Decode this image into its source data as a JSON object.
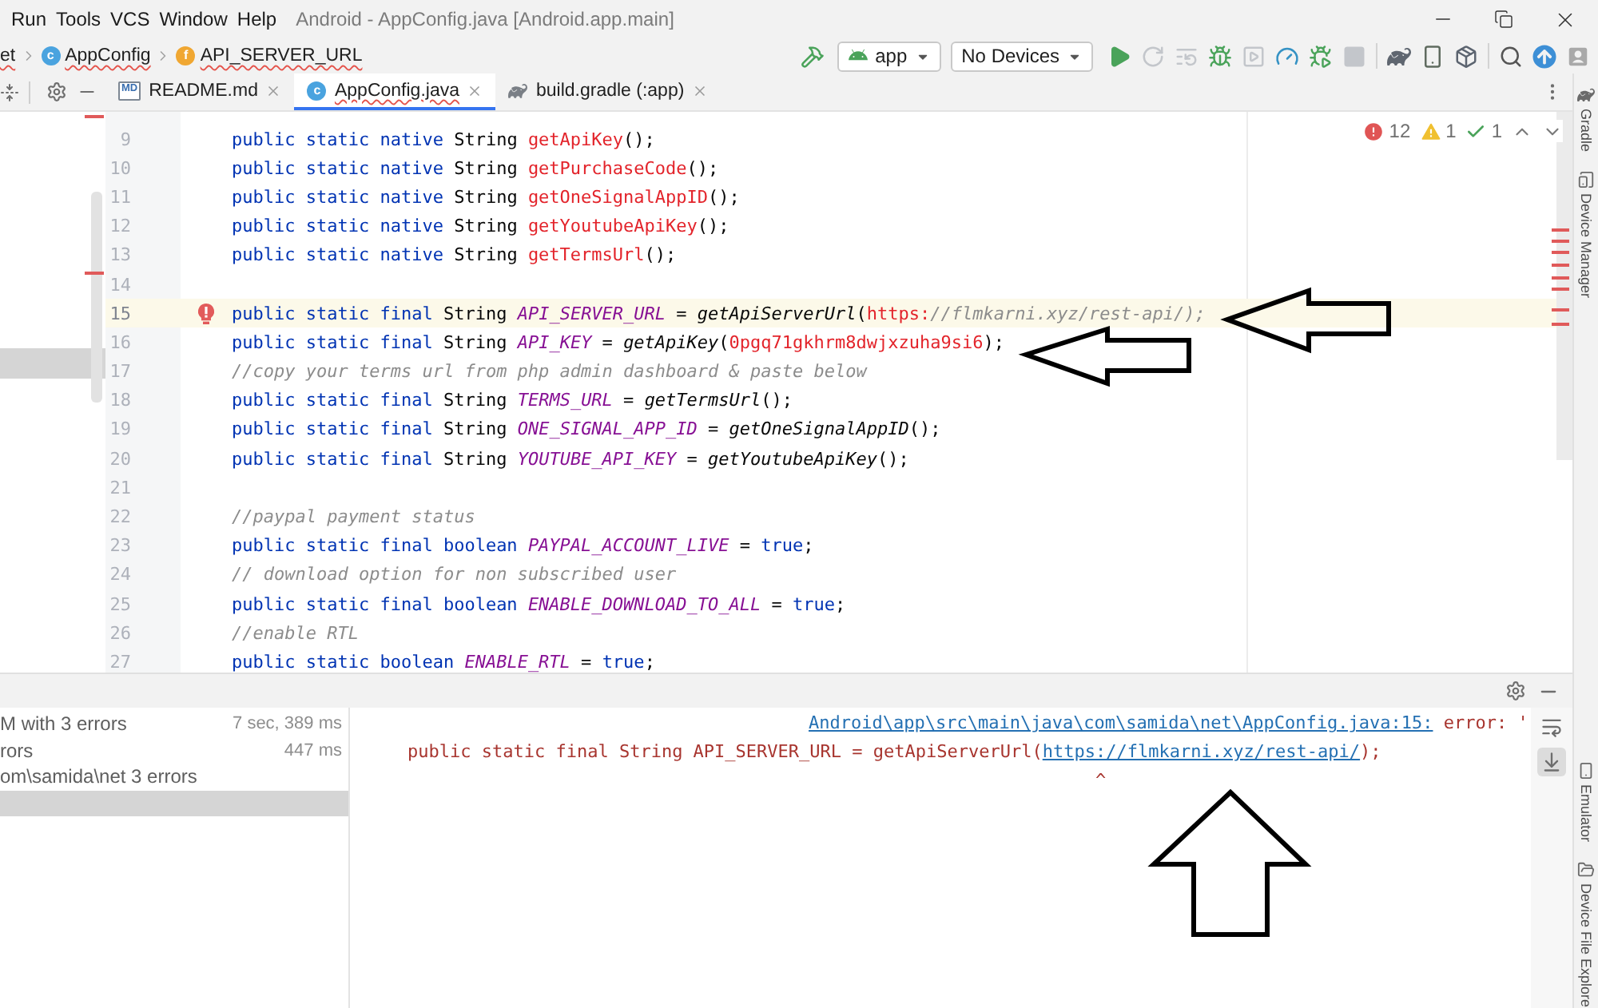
{
  "menu_bar": {
    "items": [
      "Run",
      "Tools",
      "VCS",
      "Window",
      "Help"
    ],
    "title": "Android - AppConfig.java [Android.app.main]"
  },
  "breadcrumbs": [
    {
      "label": "et",
      "kind": "package",
      "error": true
    },
    {
      "label": "AppConfig",
      "kind": "class",
      "icon_text": "c",
      "error": true
    },
    {
      "label": "API_SERVER_URL",
      "kind": "field",
      "icon_text": "f",
      "error": true
    }
  ],
  "run_config": {
    "module": "app",
    "device": "No Devices"
  },
  "action_groups": [
    [
      {
        "kind": "run",
        "disabled": false
      },
      {
        "kind": "rerun",
        "disabled": true
      },
      {
        "kind": "apply_changes",
        "disabled": true
      },
      {
        "kind": "debug",
        "disabled": false
      },
      {
        "kind": "attach",
        "disabled": true
      },
      {
        "kind": "profile",
        "disabled": false
      },
      {
        "kind": "attach_debugger",
        "disabled": false
      },
      {
        "kind": "stop",
        "disabled": true
      }
    ],
    [
      {
        "kind": "gradle_sync",
        "disabled": false
      },
      {
        "kind": "device_manager",
        "disabled": false
      },
      {
        "kind": "sdk_manager",
        "disabled": false
      }
    ],
    [
      {
        "kind": "search",
        "disabled": false
      },
      {
        "kind": "update",
        "disabled": false
      },
      {
        "kind": "account",
        "disabled": false
      }
    ]
  ],
  "editor_tabs": [
    {
      "label": "README.md",
      "kind": "markdown",
      "icon_text": "MD",
      "selected": false,
      "error": false
    },
    {
      "label": "AppConfig.java",
      "kind": "class",
      "icon_text": "c",
      "selected": true,
      "error": true
    },
    {
      "label": "build.gradle (:app)",
      "kind": "gradle",
      "selected": false,
      "error": false
    }
  ],
  "project_tree": [
    {
      "selected": false
    },
    {
      "selected": false
    },
    {
      "selected": false
    },
    {
      "selected": false
    },
    {
      "selected": false
    },
    {
      "selected": false
    },
    {
      "selected": false
    },
    {
      "selected": false
    },
    {
      "selected": true
    }
  ],
  "inspections": {
    "errors": "12",
    "warnings": "1",
    "typos": "1"
  },
  "code_lines": [
    {
      "number": "9",
      "current": false,
      "error_mark": false,
      "tokens": [
        {
          "kind": "keyword",
          "text": "public static native"
        },
        {
          "kind": "plain",
          "text": " String "
        },
        {
          "kind": "error",
          "text": "getApiKey"
        },
        {
          "kind": "plain",
          "text": "();"
        }
      ]
    },
    {
      "number": "10",
      "current": false,
      "error_mark": false,
      "tokens": [
        {
          "kind": "keyword",
          "text": "public static native"
        },
        {
          "kind": "plain",
          "text": " String "
        },
        {
          "kind": "error",
          "text": "getPurchaseCode"
        },
        {
          "kind": "plain",
          "text": "();"
        }
      ]
    },
    {
      "number": "11",
      "current": false,
      "error_mark": false,
      "tokens": [
        {
          "kind": "keyword",
          "text": "public static native"
        },
        {
          "kind": "plain",
          "text": " String "
        },
        {
          "kind": "error",
          "text": "getOneSignalAppID"
        },
        {
          "kind": "plain",
          "text": "();"
        }
      ]
    },
    {
      "number": "12",
      "current": false,
      "error_mark": false,
      "tokens": [
        {
          "kind": "keyword",
          "text": "public static native"
        },
        {
          "kind": "plain",
          "text": " String "
        },
        {
          "kind": "error",
          "text": "getYoutubeApiKey"
        },
        {
          "kind": "plain",
          "text": "();"
        }
      ]
    },
    {
      "number": "13",
      "current": false,
      "error_mark": false,
      "tokens": [
        {
          "kind": "keyword",
          "text": "public static native"
        },
        {
          "kind": "plain",
          "text": " String "
        },
        {
          "kind": "error",
          "text": "getTermsUrl"
        },
        {
          "kind": "plain",
          "text": "();"
        }
      ]
    },
    {
      "number": "14",
      "current": false,
      "error_mark": false
    },
    {
      "number": "15",
      "current": true,
      "error_mark": true,
      "tokens": [
        {
          "kind": "keyword",
          "text": "public static final"
        },
        {
          "kind": "plain",
          "text": " String "
        },
        {
          "kind": "field",
          "text": "API_SERVER_URL"
        },
        {
          "kind": "plain",
          "text": " = "
        },
        {
          "kind": "call",
          "text": "getApiServerUrl"
        },
        {
          "kind": "plain",
          "text": "("
        },
        {
          "kind": "error",
          "text": "https:"
        },
        {
          "kind": "comment",
          "text": "//flmkarni.xyz/rest-api/);"
        }
      ]
    },
    {
      "number": "16",
      "current": false,
      "error_mark": false,
      "tokens": [
        {
          "kind": "keyword",
          "text": "public static final"
        },
        {
          "kind": "plain",
          "text": " String "
        },
        {
          "kind": "field",
          "text": "API_KEY"
        },
        {
          "kind": "plain",
          "text": " = "
        },
        {
          "kind": "call",
          "text": "getApiKey"
        },
        {
          "kind": "plain",
          "text": "("
        },
        {
          "kind": "error",
          "text": "0pgq71gkhrm8dwjxzuha9si6"
        },
        {
          "kind": "plain",
          "text": ");"
        }
      ]
    },
    {
      "number": "17",
      "current": false,
      "error_mark": false,
      "tokens": [
        {
          "kind": "comment",
          "text": "//copy your terms url from php admin dashboard & paste below"
        }
      ]
    },
    {
      "number": "18",
      "current": false,
      "error_mark": false,
      "tokens": [
        {
          "kind": "keyword",
          "text": "public static final"
        },
        {
          "kind": "plain",
          "text": " String "
        },
        {
          "kind": "field",
          "text": "TERMS_URL"
        },
        {
          "kind": "plain",
          "text": " = "
        },
        {
          "kind": "call",
          "text": "getTermsUrl"
        },
        {
          "kind": "plain",
          "text": "();"
        }
      ]
    },
    {
      "number": "19",
      "current": false,
      "error_mark": false,
      "tokens": [
        {
          "kind": "keyword",
          "text": "public static final"
        },
        {
          "kind": "plain",
          "text": " String "
        },
        {
          "kind": "field",
          "text": "ONE_SIGNAL_APP_ID"
        },
        {
          "kind": "plain",
          "text": " = "
        },
        {
          "kind": "call",
          "text": "getOneSignalAppID"
        },
        {
          "kind": "plain",
          "text": "();"
        }
      ]
    },
    {
      "number": "20",
      "current": false,
      "error_mark": false,
      "tokens": [
        {
          "kind": "keyword",
          "text": "public static final"
        },
        {
          "kind": "plain",
          "text": " String "
        },
        {
          "kind": "field",
          "text": "YOUTUBE_API_KEY"
        },
        {
          "kind": "plain",
          "text": " = "
        },
        {
          "kind": "call",
          "text": "getYoutubeApiKey"
        },
        {
          "kind": "plain",
          "text": "();"
        }
      ]
    },
    {
      "number": "21",
      "current": false,
      "error_mark": false
    },
    {
      "number": "22",
      "current": false,
      "error_mark": false,
      "tokens": [
        {
          "kind": "comment",
          "text": "//paypal payment status"
        }
      ]
    },
    {
      "number": "23",
      "current": false,
      "error_mark": false,
      "tokens": [
        {
          "kind": "keyword",
          "text": "public static final boolean "
        },
        {
          "kind": "field",
          "text": "PAYPAL_ACCOUNT_LIVE"
        },
        {
          "kind": "plain",
          "text": " = "
        },
        {
          "kind": "keyword",
          "text": "true"
        },
        {
          "kind": "plain",
          "text": ";"
        }
      ]
    },
    {
      "number": "24",
      "current": false,
      "error_mark": false,
      "tokens": [
        {
          "kind": "comment",
          "text": "// download option for non subscribed user"
        }
      ]
    },
    {
      "number": "25",
      "current": false,
      "error_mark": false,
      "tokens": [
        {
          "kind": "keyword",
          "text": "public static final boolean "
        },
        {
          "kind": "field",
          "text": "ENABLE_DOWNLOAD_TO_ALL"
        },
        {
          "kind": "plain",
          "text": " = "
        },
        {
          "kind": "keyword",
          "text": "true"
        },
        {
          "kind": "plain",
          "text": ";"
        }
      ]
    },
    {
      "number": "26",
      "current": false,
      "error_mark": false,
      "tokens": [
        {
          "kind": "comment",
          "text": "//enable RTL"
        }
      ]
    },
    {
      "number": "27",
      "current": false,
      "error_mark": false,
      "tokens": [
        {
          "kind": "keyword",
          "text": "public static boolean "
        },
        {
          "kind": "field",
          "text": "ENABLE_RTL"
        },
        {
          "kind": "plain",
          "text": " = "
        },
        {
          "kind": "keyword",
          "text": "true"
        },
        {
          "kind": "plain",
          "text": ";"
        }
      ]
    }
  ],
  "tool_strip": {
    "top": [
      {
        "label": "Gradle",
        "kind": "gradle"
      },
      {
        "label": "Device Manager",
        "kind": "device"
      }
    ],
    "bottom": [
      {
        "label": "Emulator",
        "kind": "emulator"
      },
      {
        "label": "Device File Explore",
        "kind": "files"
      }
    ]
  },
  "build_tree": [
    {
      "label": "M with 3 errors",
      "time": "7 sec, 389 ms",
      "selected": false
    },
    {
      "label": "rors",
      "time": "447 ms",
      "selected": false
    },
    {
      "label": "om\\samida\\net 3 errors",
      "selected": false
    },
    {
      "selected": true
    }
  ],
  "console": {
    "location": "Android\\app\\src\\main\\java\\com\\samida\\net\\AppConfig.java:15:",
    "message": "error: '",
    "source": [
      {
        "kind": "text",
        "text": "public static final String API_SERVER_URL = getApiServerUrl("
      },
      {
        "kind": "link",
        "text": "https://flmkarni.xyz/rest-api/"
      },
      {
        "kind": "text",
        "text": ");"
      }
    ],
    "caret": "^",
    "soft_wrap": false,
    "scroll_to_end": true
  }
}
